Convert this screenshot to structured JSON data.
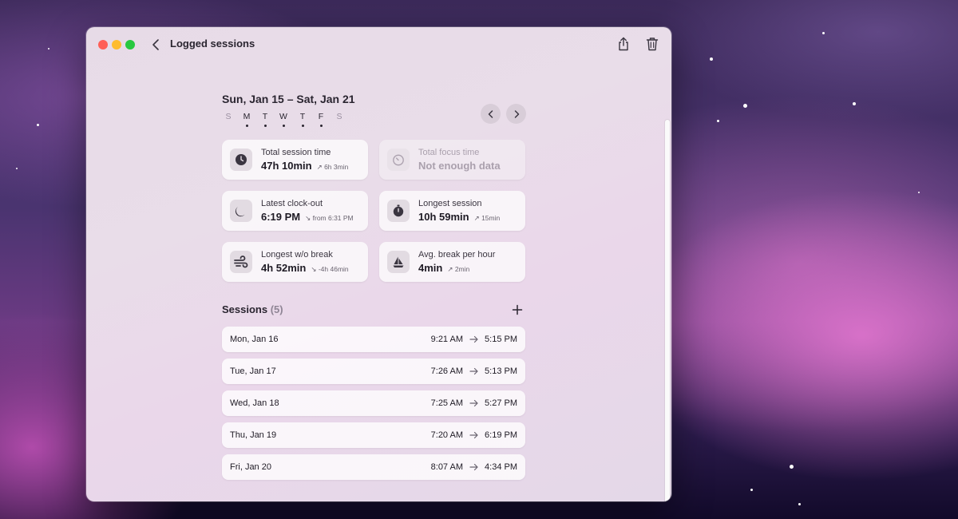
{
  "window": {
    "title": "Logged sessions",
    "traffic_colors": {
      "close": "#ff5f57",
      "minimize": "#febc2e",
      "zoom": "#28c840"
    }
  },
  "week": {
    "title": "Sun, Jan 15 – Sat, Jan 21",
    "days": [
      {
        "letter": "S",
        "active": false
      },
      {
        "letter": "M",
        "active": true
      },
      {
        "letter": "T",
        "active": true
      },
      {
        "letter": "W",
        "active": true
      },
      {
        "letter": "T",
        "active": true
      },
      {
        "letter": "F",
        "active": true
      },
      {
        "letter": "S",
        "active": false
      }
    ]
  },
  "stats": [
    {
      "label": "Total session time",
      "value": "47h 10min",
      "delta": "↗ 6h 3min",
      "icon": "clock-icon",
      "disabled": false
    },
    {
      "label": "Total focus time",
      "value": "Not enough data",
      "delta": "",
      "icon": "timer-icon",
      "disabled": true
    },
    {
      "label": "Latest clock-out",
      "value": "6:19 PM",
      "delta": "↘ from 6:31 PM",
      "icon": "moon-icon",
      "disabled": false
    },
    {
      "label": "Longest session",
      "value": "10h 59min",
      "delta": "↗ 15min",
      "icon": "stopwatch-icon",
      "disabled": false
    },
    {
      "label": "Longest w/o break",
      "value": "4h 52min",
      "delta": "↘ -4h 46min",
      "icon": "wind-icon",
      "disabled": false
    },
    {
      "label": "Avg. break per hour",
      "value": "4min",
      "delta": "↗ 2min",
      "icon": "sailboat-icon",
      "disabled": false
    }
  ],
  "sessions": {
    "heading": "Sessions",
    "count": "(5)",
    "rows": [
      {
        "date": "Mon, Jan 16",
        "start": "9:21 AM",
        "end": "5:15 PM"
      },
      {
        "date": "Tue, Jan 17",
        "start": "7:26 AM",
        "end": "5:13 PM"
      },
      {
        "date": "Wed, Jan 18",
        "start": "7:25 AM",
        "end": "5:27 PM"
      },
      {
        "date": "Thu, Jan 19",
        "start": "7:20 AM",
        "end": "6:19 PM"
      },
      {
        "date": "Fri, Jan 20",
        "start": "8:07 AM",
        "end": "4:34 PM"
      }
    ]
  }
}
